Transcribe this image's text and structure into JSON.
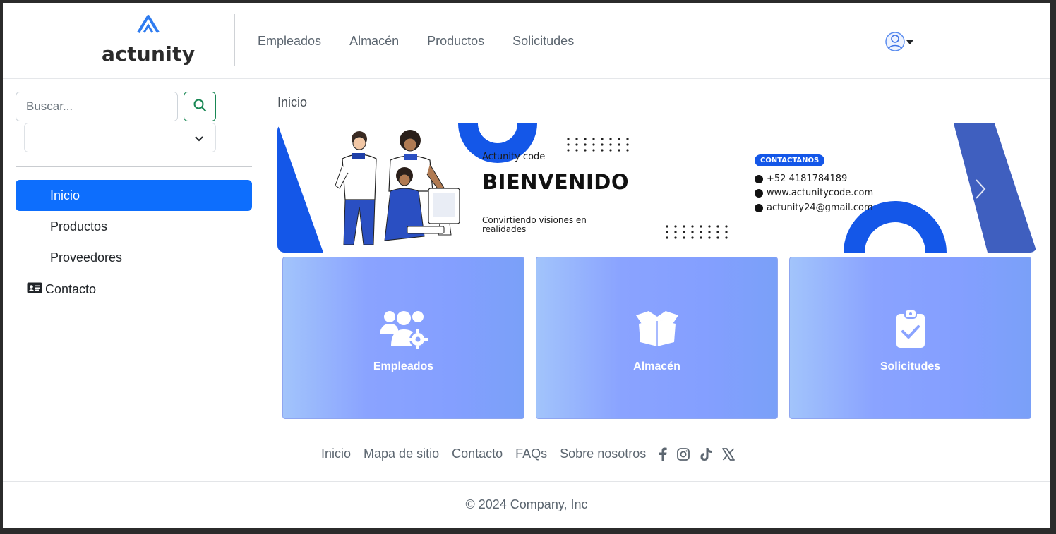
{
  "brand": {
    "name": "actunity",
    "logo_icon": "actunity-logo-icon"
  },
  "topnav": [
    {
      "label": "Empleados"
    },
    {
      "label": "Almacén"
    },
    {
      "label": "Productos"
    },
    {
      "label": "Solicitudes"
    }
  ],
  "user_menu": {
    "icon": "user-icon"
  },
  "sidebar": {
    "search_placeholder": "Buscar...",
    "select_value": "",
    "items": [
      {
        "label": "Inicio",
        "active": true
      },
      {
        "label": "Productos"
      },
      {
        "label": "Proveedores"
      }
    ],
    "contacto_label": "Contacto"
  },
  "breadcrumb": "Inicio",
  "banner": {
    "tag": "Actunity code",
    "title": "BIENVENIDO",
    "subtitle": "Convirtiendo visiones en realidades",
    "contact_badge": "CONTACTANOS",
    "phone": "+52 4181784189",
    "website": "www.actunitycode.com",
    "email": "actunity24@gmail.com",
    "accent": "#1457e8"
  },
  "cards": [
    {
      "label": "Empleados",
      "icon": "users-gear-icon"
    },
    {
      "label": "Almacén",
      "icon": "open-box-icon"
    },
    {
      "label": "Solicitudes",
      "icon": "clipboard-check-icon"
    }
  ],
  "footer": {
    "links": [
      {
        "label": "Inicio"
      },
      {
        "label": "Mapa de sitio"
      },
      {
        "label": "Contacto"
      },
      {
        "label": "FAQs"
      },
      {
        "label": "Sobre nosotros"
      }
    ],
    "social": [
      "facebook-icon",
      "instagram-icon",
      "tiktok-icon",
      "x-icon"
    ],
    "copyright": "© 2024 Company, Inc"
  },
  "colors": {
    "primary": "#0d6efd",
    "success": "#198754",
    "card_gradient": "#8aa3ff"
  }
}
